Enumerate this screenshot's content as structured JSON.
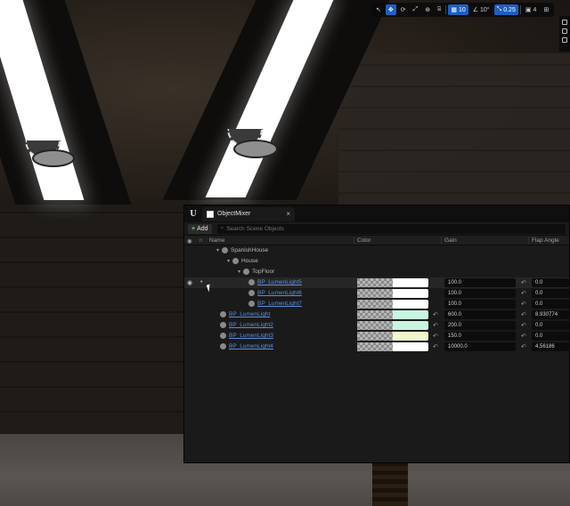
{
  "viewport_toolbar": {
    "items": [
      {
        "icon": "select-arrow-icon",
        "label": "",
        "active": false
      },
      {
        "icon": "move-icon",
        "label": "",
        "active": true
      },
      {
        "icon": "rotate-icon",
        "label": "",
        "active": false
      },
      {
        "icon": "scale-icon",
        "label": "",
        "active": false
      },
      {
        "icon": "world-icon",
        "label": "",
        "active": false
      },
      {
        "icon": "surface-snap-icon",
        "label": "",
        "active": false
      },
      {
        "icon": "grid-snap-icon",
        "label": "10",
        "active": true
      },
      {
        "icon": "angle-snap-icon",
        "label": "10°",
        "active": false
      },
      {
        "icon": "scale-snap-icon",
        "label": "0.25",
        "active": true
      },
      {
        "icon": "camera-speed-icon",
        "label": "4",
        "active": false
      },
      {
        "icon": "maximize-icon",
        "label": "",
        "active": false
      }
    ]
  },
  "mixer": {
    "tab_title": "ObjectMixer",
    "add_label": "Add",
    "search_placeholder": "Search Scene Objects",
    "columns": {
      "name": "Name",
      "color": "Color",
      "gain": "Gain",
      "flap": "Flap Angle"
    },
    "rows": [
      {
        "name": "SpanishHouse",
        "indent": 0,
        "arrow": "▾",
        "link": false,
        "visible": false,
        "swatch": null,
        "gain": null,
        "flap": null
      },
      {
        "name": "House",
        "indent": 1,
        "arrow": "▾",
        "link": false,
        "visible": false,
        "swatch": null,
        "gain": null,
        "flap": null
      },
      {
        "name": "TopFloor",
        "indent": 2,
        "arrow": "▾",
        "link": false,
        "visible": false,
        "swatch": null,
        "gain": null,
        "flap": null
      },
      {
        "name": "BP_LumenLight5",
        "indent": 3,
        "arrow": "",
        "link": true,
        "visible": true,
        "selected": true,
        "swatch": "#ffffff",
        "gain": "100.0",
        "flap": "0.0",
        "gain_reset": false
      },
      {
        "name": "BP_LumenLight6",
        "indent": 3,
        "arrow": "",
        "link": true,
        "visible": false,
        "swatch": "#ffffff",
        "gain": "100.0",
        "flap": "0.0",
        "gain_reset": false
      },
      {
        "name": "BP_LumenLight7",
        "indent": 3,
        "arrow": "",
        "link": true,
        "visible": false,
        "swatch": "#ffffff",
        "gain": "100.0",
        "flap": "0.0",
        "gain_reset": false
      },
      {
        "name": "BP_LumenLight",
        "indent": 0,
        "arrow": "",
        "link": true,
        "visible": false,
        "swatch": "#c8f5e0",
        "gain": "600.0",
        "flap": "8.930774",
        "gain_reset": true
      },
      {
        "name": "BP_LumenLight2",
        "indent": 0,
        "arrow": "",
        "link": true,
        "visible": false,
        "swatch": "#c8f5e0",
        "gain": "200.0",
        "flap": "0.0",
        "gain_reset": true
      },
      {
        "name": "BP_LumenLight3",
        "indent": 0,
        "arrow": "",
        "link": true,
        "visible": false,
        "swatch": "#eef8cc",
        "gain": "150.0",
        "flap": "0.0",
        "gain_reset": true
      },
      {
        "name": "BP_LumenLight4",
        "indent": 0,
        "arrow": "",
        "link": true,
        "visible": false,
        "swatch": "#ffffff",
        "gain": "10000.0",
        "flap": "4.56186",
        "gain_reset": true
      }
    ]
  },
  "colors": {
    "accent": "#1f5fbf",
    "link": "#5a8fe0",
    "panel": "#1a1a1a"
  }
}
